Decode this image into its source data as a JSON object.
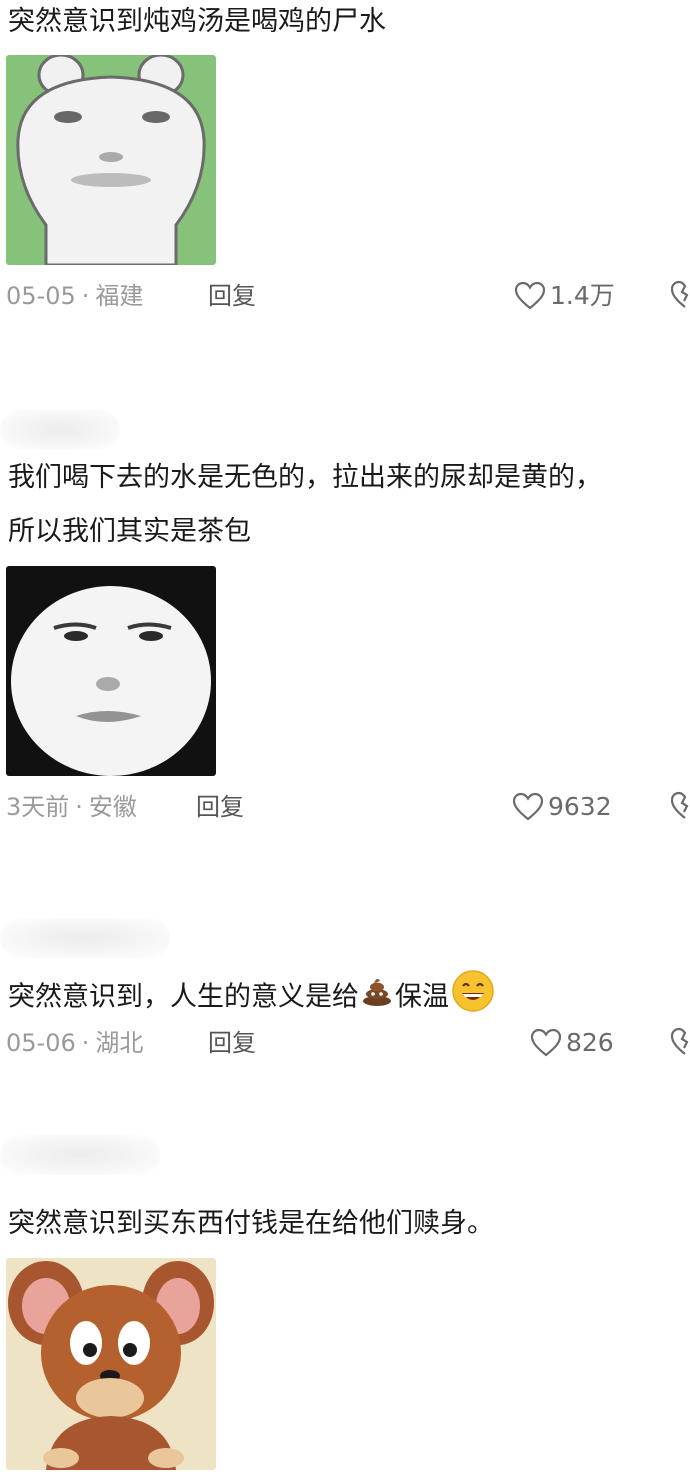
{
  "comments": [
    {
      "text": "突然意识到炖鸡汤是喝鸡的尸水",
      "date": "05-05",
      "location": "福建",
      "reply_label": "回复",
      "likes": "1.4万",
      "sticker": "meme-face-bear-green"
    },
    {
      "text_line1": "我们喝下去的水是无色的，拉出来的尿却是黄的，",
      "text_line2": "所以我们其实是茶包",
      "date": "3天前",
      "location": "安徽",
      "reply_label": "回复",
      "likes": "9632",
      "sticker": "meme-face-panda"
    },
    {
      "text_part1": "突然意识到，人生的意义是给",
      "emoji1": "poop-emoji",
      "text_part2": "保温",
      "emoji2": "grinning-emoji",
      "date": "05-06",
      "location": "湖北",
      "reply_label": "回复",
      "likes": "826"
    },
    {
      "text": "突然意识到买东西付钱是在给他们赎身。",
      "sticker": "jerry-mouse-sticker"
    }
  ],
  "separator": "·",
  "colors": {
    "text": "#1a1a1a",
    "meta": "#9a9a9a",
    "reply": "#555555",
    "sticker_green": "#86c27a",
    "sticker_jerry_bg": "#efe3c5"
  }
}
